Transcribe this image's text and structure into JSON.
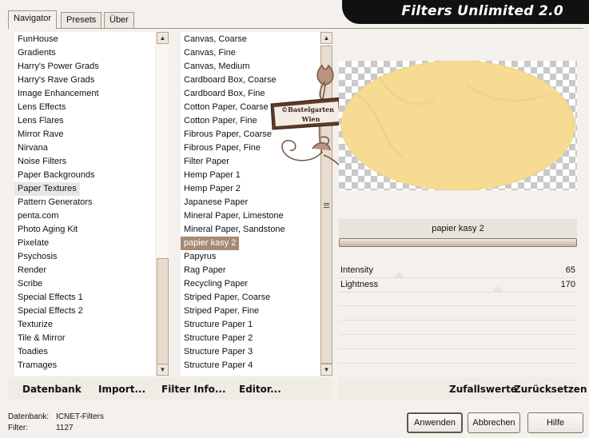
{
  "app_title": "Filters Unlimited 2.0",
  "tabs": [
    "Navigator",
    "Presets",
    "Über"
  ],
  "categories": [
    "FunHouse",
    "Gradients",
    "Harry's Power Grads",
    "Harry's Rave Grads",
    "Image Enhancement",
    "Lens Effects",
    "Lens Flares",
    "Mirror Rave",
    "Nirvana",
    "Noise Filters",
    "Paper Backgrounds",
    "Paper Textures",
    "Pattern Generators",
    "penta.com",
    "Photo Aging Kit",
    "Pixelate",
    "Psychosis",
    "Render",
    "Scribe",
    "Special Effects 1",
    "Special Effects 2",
    "Texturize",
    "Tile & Mirror",
    "Toadies",
    "Tramages"
  ],
  "selected_category": "Paper Textures",
  "filters": [
    "Canvas, Coarse",
    "Canvas, Fine",
    "Canvas, Medium",
    "Cardboard Box, Coarse",
    "Cardboard Box, Fine",
    "Cotton Paper, Coarse",
    "Cotton Paper, Fine",
    "Fibrous Paper, Coarse",
    "Fibrous Paper, Fine",
    "Filter Paper",
    "Hemp Paper 1",
    "Hemp Paper 2",
    "Japanese Paper",
    "Mineral Paper, Limestone",
    "Mineral Paper, Sandstone",
    "papier kasy 2",
    "Papyrus",
    "Rag Paper",
    "Recycling Paper",
    "Striped Paper, Coarse",
    "Striped Paper, Fine",
    "Structure Paper 1",
    "Structure Paper 2",
    "Structure Paper 3",
    "Structure Paper 4"
  ],
  "selected_filter": "papier kasy 2",
  "watermark": "©Bastelgarten Wien",
  "preview": {
    "shape_color": "#f6dc92"
  },
  "current_filter_name": "papier kasy 2",
  "parameters": [
    {
      "label": "Intensity",
      "value": "65",
      "level": 0.255
    },
    {
      "label": "Lightness",
      "value": "170",
      "level": 0.667
    }
  ],
  "bottom_links": {
    "datenbank": "Datenbank",
    "import": "Import...",
    "filter_info": "Filter Info...",
    "editor": "Editor...",
    "zufallswerte": "Zufallswerte",
    "zuruecksetzen": "Zurücksetzen"
  },
  "status": {
    "datenbank_label": "Datenbank:",
    "datenbank_value": "ICNET-Filters",
    "filter_label": "Filter:",
    "filter_value": "1127"
  },
  "buttons": {
    "apply": "Anwenden",
    "cancel": "Abbrechen",
    "help": "Hilfe"
  }
}
